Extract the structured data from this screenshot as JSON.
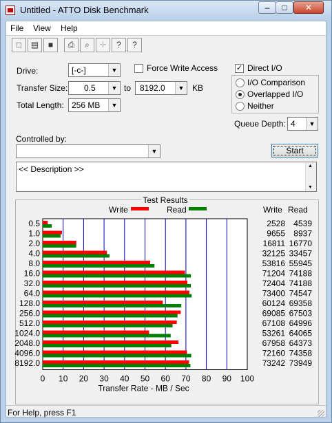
{
  "window": {
    "title": "Untitled - ATTO Disk Benchmark",
    "buttons": {
      "min": "–",
      "max": "□",
      "close": "✕"
    }
  },
  "menu": [
    {
      "label": "File"
    },
    {
      "label": "View"
    },
    {
      "label": "Help"
    }
  ],
  "toolbar": [
    {
      "icon": "new-document-icon",
      "glyph": "□"
    },
    {
      "icon": "open-folder-icon",
      "glyph": "▤"
    },
    {
      "icon": "save-icon",
      "glyph": "■"
    },
    {
      "icon": "print-icon",
      "glyph": "⎙"
    },
    {
      "icon": "print-preview-icon",
      "glyph": "⌕"
    },
    {
      "icon": "move-icon",
      "glyph": "✛"
    },
    {
      "icon": "help-icon",
      "glyph": "?"
    },
    {
      "icon": "context-help-icon",
      "glyph": "?"
    }
  ],
  "settings": {
    "drive_label": "Drive:",
    "drive_value": "[-c-]",
    "force_write_label": "Force Write Access",
    "force_write_checked": false,
    "direct_io_label": "Direct I/O",
    "direct_io_checked": true,
    "transfer_label": "Transfer Size:",
    "transfer_from": "0.5",
    "transfer_to_label": "to",
    "transfer_to": "8192.0",
    "transfer_unit": "KB",
    "total_length_label": "Total Length:",
    "total_length": "256 MB",
    "io_options": [
      {
        "label": "I/O Comparison",
        "selected": false
      },
      {
        "label": "Overlapped I/O",
        "selected": true
      },
      {
        "label": "Neither",
        "selected": false
      }
    ],
    "queue_depth_label": "Queue Depth:",
    "queue_depth": "4",
    "controlled_by_label": "Controlled by:",
    "controlled_by_value": "",
    "start_label": "Start",
    "description": "<< Description >>"
  },
  "results": {
    "title": "Test Results",
    "legend_write": "Write",
    "legend_read": "Read",
    "col_write": "Write",
    "col_read": "Read",
    "write_color": "#ff0000",
    "read_color": "#008000",
    "grid_color": "#0000cc"
  },
  "chart_data": {
    "type": "bar",
    "orientation": "horizontal",
    "title": "Test Results",
    "xlabel": "Transfer Rate - MB / Sec",
    "xlim": [
      0,
      100
    ],
    "xticks": [
      "0",
      "10",
      "20",
      "30",
      "40",
      "50",
      "60",
      "70",
      "80",
      "90",
      "100"
    ],
    "categories": [
      "0.5",
      "1.0",
      "2.0",
      "4.0",
      "8.0",
      "16.0",
      "32.0",
      "64.0",
      "128.0",
      "256.0",
      "512.0",
      "1024.0",
      "2048.0",
      "4096.0",
      "8192.0"
    ],
    "series": [
      {
        "name": "Write",
        "color": "#ff0000",
        "values": [
          2.47,
          9.43,
          16.42,
          31.37,
          52.55,
          69.54,
          70.71,
          71.68,
          58.71,
          67.47,
          65.54,
          52.01,
          66.37,
          70.47,
          71.53
        ]
      },
      {
        "name": "Read",
        "color": "#008000",
        "values": [
          4.43,
          8.73,
          16.38,
          32.67,
          54.64,
          72.45,
          72.44,
          72.8,
          67.73,
          65.92,
          63.47,
          62.56,
          62.86,
          72.61,
          72.22
        ]
      }
    ],
    "write_values": [
      "2528",
      "9655",
      "16811",
      "32125",
      "53816",
      "71204",
      "72404",
      "73400",
      "60124",
      "69085",
      "67108",
      "53261",
      "67958",
      "72160",
      "73242"
    ],
    "read_values": [
      "4539",
      "8937",
      "16770",
      "33457",
      "55945",
      "74188",
      "74188",
      "74547",
      "69358",
      "67503",
      "64996",
      "64065",
      "64373",
      "74358",
      "73949"
    ]
  },
  "status": {
    "text": "For Help, press F1"
  }
}
